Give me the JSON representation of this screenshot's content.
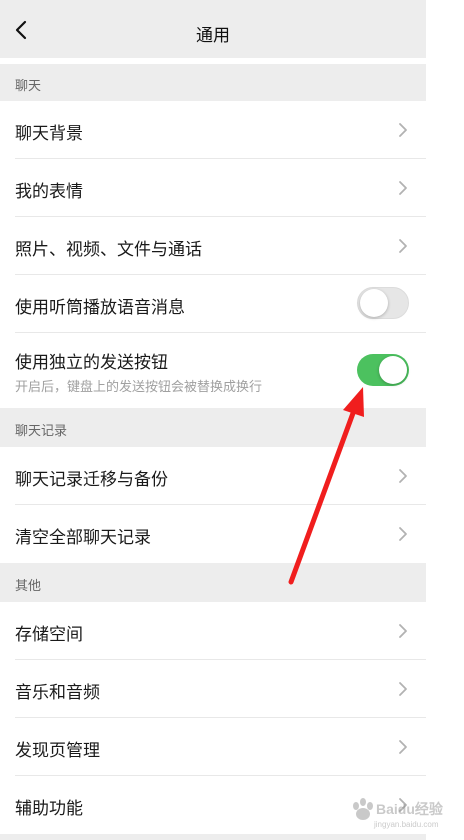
{
  "nav": {
    "title": "通用"
  },
  "sections": {
    "chat": {
      "header": "聊天",
      "items": [
        {
          "label": "聊天背景"
        },
        {
          "label": "我的表情"
        },
        {
          "label": "照片、视频、文件与通话"
        },
        {
          "label": "使用听筒播放语音消息",
          "toggle": "off"
        },
        {
          "label": "使用独立的发送按钮",
          "sub": "开启后，键盘上的发送按钮会被替换成换行",
          "toggle": "on"
        }
      ]
    },
    "history": {
      "header": "聊天记录",
      "items": [
        {
          "label": "聊天记录迁移与备份"
        },
        {
          "label": "清空全部聊天记录"
        }
      ]
    },
    "other": {
      "header": "其他",
      "items": [
        {
          "label": "存储空间"
        },
        {
          "label": "音乐和音频"
        },
        {
          "label": "发现页管理"
        },
        {
          "label": "辅助功能"
        }
      ]
    }
  },
  "colors": {
    "accent": "#4cc15f",
    "arrow": "#f01e1e",
    "background": "#ededed"
  },
  "watermark": {
    "text": "Baidu经验",
    "sub": "jingyan.baidu.com"
  }
}
